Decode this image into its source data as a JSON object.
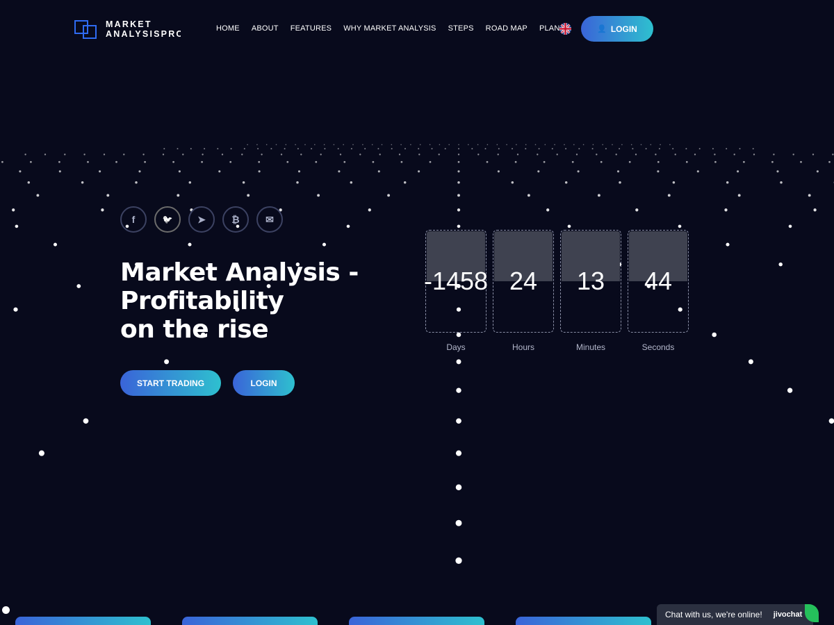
{
  "logo": {
    "line1": "MARKET",
    "line2": "ANALYSISPRO"
  },
  "nav": [
    "HOME",
    "ABOUT",
    "FEATURES",
    "WHY MARKET ANALYSIS",
    "STEPS",
    "ROAD MAP",
    "PLANS"
  ],
  "header": {
    "login_label": "LOGIN"
  },
  "socials": [
    {
      "icon": "facebook-icon",
      "glyph": "f"
    },
    {
      "icon": "twitter-icon",
      "glyph": "🐦"
    },
    {
      "icon": "telegram-icon",
      "glyph": "➤"
    },
    {
      "icon": "bitcoin-icon",
      "glyph": "₿"
    },
    {
      "icon": "mail-icon",
      "glyph": "✉"
    }
  ],
  "hero": {
    "title_line1": "Market Analysis -",
    "title_line2": "Profitability",
    "title_line3": "on the rise",
    "start_label": "START TRADING",
    "login_label": "LOGIN"
  },
  "countdown": [
    {
      "value": "-1458",
      "label": "Days"
    },
    {
      "value": "24",
      "label": "Hours"
    },
    {
      "value": "13",
      "label": "Minutes"
    },
    {
      "value": "44",
      "label": "Seconds"
    }
  ],
  "chat": {
    "text": "Chat with us, we're online!",
    "brand": "jivochat"
  },
  "colors": {
    "background": "#080a1c",
    "accent_start": "#3a64d8",
    "accent_end": "#2ec0cf"
  }
}
